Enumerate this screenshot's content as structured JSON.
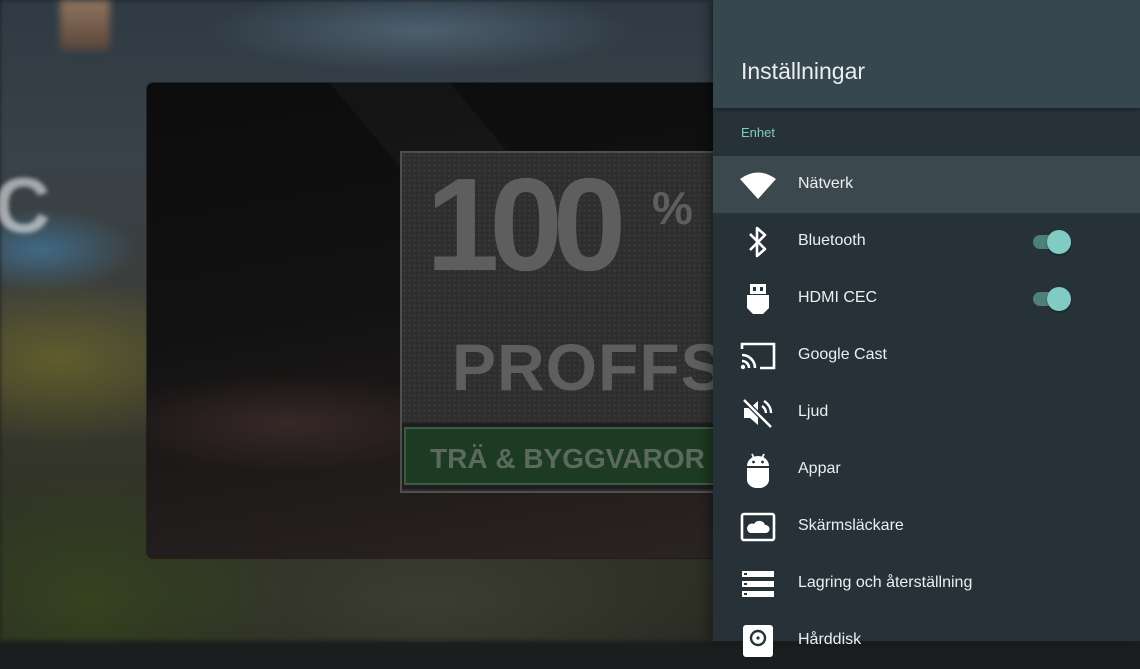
{
  "background": {
    "video_ad": {
      "big_number": "100",
      "percent": "%",
      "brand": "PROFFS",
      "tagline": "TRÄ & BYGGVAROR"
    },
    "edge_letter": "C"
  },
  "settings": {
    "title": "Inställningar",
    "section": "Enhet",
    "accent_color": "#80cbc4",
    "panel_color": "#263238",
    "header_color": "#37474f",
    "items": [
      {
        "label": "Nätverk",
        "icon": "wifi-icon",
        "selected": true
      },
      {
        "label": "Bluetooth",
        "icon": "bluetooth-icon",
        "toggle": true
      },
      {
        "label": "HDMI CEC",
        "icon": "hdmi-icon",
        "toggle": true
      },
      {
        "label": "Google Cast",
        "icon": "cast-icon"
      },
      {
        "label": "Ljud",
        "icon": "volume-off-icon"
      },
      {
        "label": "Appar",
        "icon": "android-icon"
      },
      {
        "label": "Skärmsläckare",
        "icon": "screensaver-icon"
      },
      {
        "label": "Lagring och återställning",
        "icon": "storage-icon"
      },
      {
        "label": "Hårddisk",
        "icon": "hard-disk-icon"
      }
    ]
  }
}
